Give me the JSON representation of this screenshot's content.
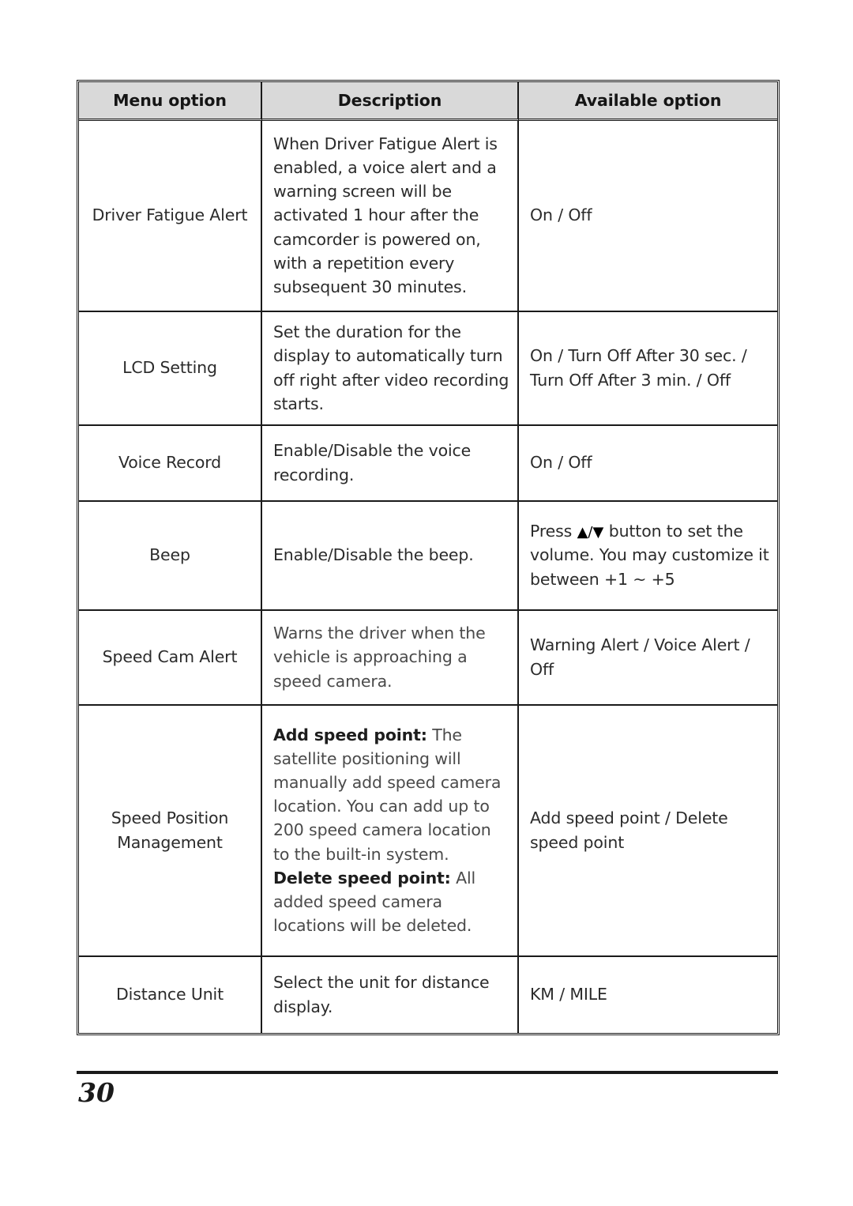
{
  "document": {
    "page_number": "30",
    "footer_rule": true
  },
  "table": {
    "headers": {
      "menu_option": "Menu option",
      "description": "Description",
      "available_option": "Available option"
    },
    "rows": [
      {
        "menu_option": "Driver Fatigue Alert",
        "description": "When Driver Fatigue Alert is enabled, a voice alert and a warning screen will be activated 1 hour after the camcorder is powered on, with a repetition every subsequent 30 minutes.",
        "available_option": "On / Off"
      },
      {
        "menu_option": "LCD Setting",
        "description": "Set the duration for the display to automatically turn off right after video recording starts.",
        "available_option": "On / Turn Off After 30 sec. / Turn Off After 3 min. / Off"
      },
      {
        "menu_option": "Voice Record",
        "description": "Enable/Disable the voice recording.",
        "available_option": "On / Off"
      },
      {
        "menu_option": "Beep",
        "description": "Enable/Disable the beep.",
        "available_option_prefix": "Press ",
        "available_option_arrow_up": "▲",
        "available_option_arrow_sep": "/",
        "available_option_arrow_down": "▼",
        "available_option_suffix": " button to set the volume. You may customize it between +1 ~ +5"
      },
      {
        "menu_option": "Speed Cam Alert",
        "description": "Warns the driver when the vehicle is approaching a speed camera.",
        "available_option": "Warning Alert / Voice Alert / Off"
      },
      {
        "menu_option": "Speed Position Management",
        "description_bold_1": "Add speed point:",
        "description_text_1": " The satellite positioning will manually add speed camera location. You can add up to 200 speed camera location to the built-in system. ",
        "description_bold_2": "Delete speed point:",
        "description_text_2": " All added speed camera locations will be deleted.",
        "available_option": "Add speed point / Delete speed point"
      },
      {
        "menu_option": "Distance Unit",
        "description": "Select the unit for distance display.",
        "available_option": "KM / MILE"
      }
    ]
  },
  "colors": {
    "header_fill": "#d9d9d9",
    "border": "#1a1a1a",
    "text": "#2b2b2b",
    "text_soft": "#4a4a4a"
  }
}
